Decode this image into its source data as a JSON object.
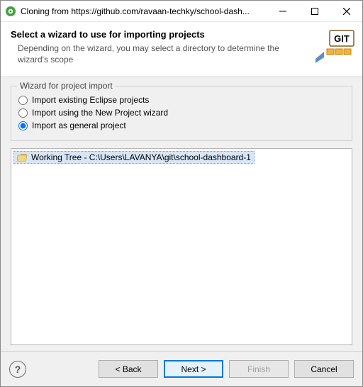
{
  "titlebar": {
    "title": "Cloning from https://github.com/ravaan-techky/school-dash..."
  },
  "header": {
    "title": "Select a wizard to use for importing projects",
    "description": "Depending on the wizard, you may select a directory to determine the wizard's scope"
  },
  "group": {
    "legend": "Wizard for project import",
    "options": {
      "existing": {
        "label": "Import existing Eclipse projects",
        "selected": false
      },
      "new_project": {
        "label": "Import using the New Project wizard",
        "selected": false
      },
      "general": {
        "label": "Import as general project",
        "selected": true
      }
    }
  },
  "tree": {
    "working_tree_label": "Working Tree - C:\\Users\\LAVANYA\\git\\school-dashboard-1"
  },
  "buttons": {
    "back": "< Back",
    "next": "Next >",
    "finish": "Finish",
    "cancel": "Cancel"
  }
}
